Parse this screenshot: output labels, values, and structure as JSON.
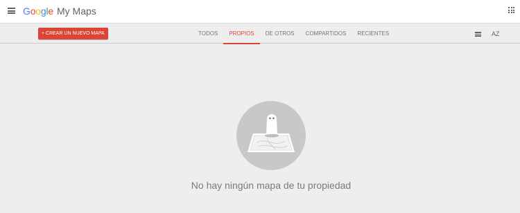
{
  "header": {
    "brand_letters": [
      {
        "char": "G",
        "color": "#4285f4"
      },
      {
        "char": "o",
        "color": "#ea4335"
      },
      {
        "char": "o",
        "color": "#fbbc05"
      },
      {
        "char": "g",
        "color": "#4285f4"
      },
      {
        "char": "l",
        "color": "#34a853"
      },
      {
        "char": "e",
        "color": "#ea4335"
      }
    ],
    "product": "My Maps",
    "menu_icon": "hamburger-menu-icon",
    "apps_icon": "apps-grid-icon"
  },
  "toolbar": {
    "create_label": "+ CREAR UN NUEVO MAPA",
    "create_color": "#db4437",
    "tabs": [
      {
        "label": "TODOS",
        "active": false
      },
      {
        "label": "PROPIOS",
        "active": true
      },
      {
        "label": "DE OTROS",
        "active": false
      },
      {
        "label": "COMPARTIDOS",
        "active": false
      },
      {
        "label": "RECIENTES",
        "active": false
      }
    ],
    "view_icon": "list-view-icon",
    "sort_label": "AZ"
  },
  "empty_state": {
    "illustration": "ghost-on-map-icon",
    "message": "No hay ningún mapa de tu propiedad"
  }
}
